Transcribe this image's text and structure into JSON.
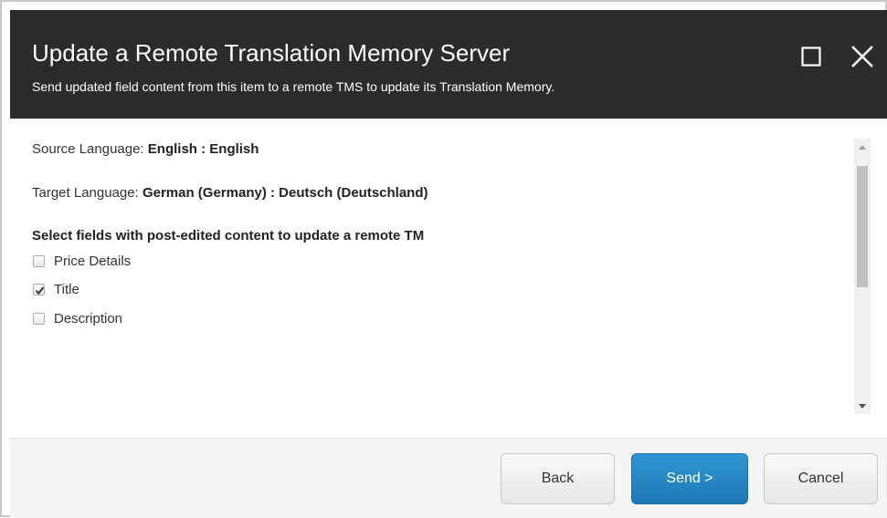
{
  "dialog": {
    "title": "Update a Remote Translation Memory Server",
    "subtitle": "Send updated field content from this item to a remote TMS to update its Translation Memory."
  },
  "body": {
    "source_label": "Source Language: ",
    "source_value": "English : English",
    "target_label": "Target Language: ",
    "target_value": "German (Germany) : Deutsch (Deutschland)",
    "fields_heading": "Select fields with post-edited content to update a remote TM",
    "fields": [
      {
        "label": "Price Details",
        "checked": false
      },
      {
        "label": "Title",
        "checked": true
      },
      {
        "label": "Description",
        "checked": false
      }
    ]
  },
  "footer": {
    "back_label": "Back",
    "send_label": "Send >",
    "cancel_label": "Cancel"
  },
  "colors": {
    "header_bg": "#2b2b2b",
    "primary_button": "#2385c4",
    "footer_bg": "#f4f4f4"
  },
  "icons": {
    "maximize": "maximize-icon",
    "close": "close-icon",
    "checkmark": "checkmark-icon",
    "scroll_up": "scroll-up-arrow-icon",
    "scroll_down": "scroll-down-arrow-icon"
  }
}
